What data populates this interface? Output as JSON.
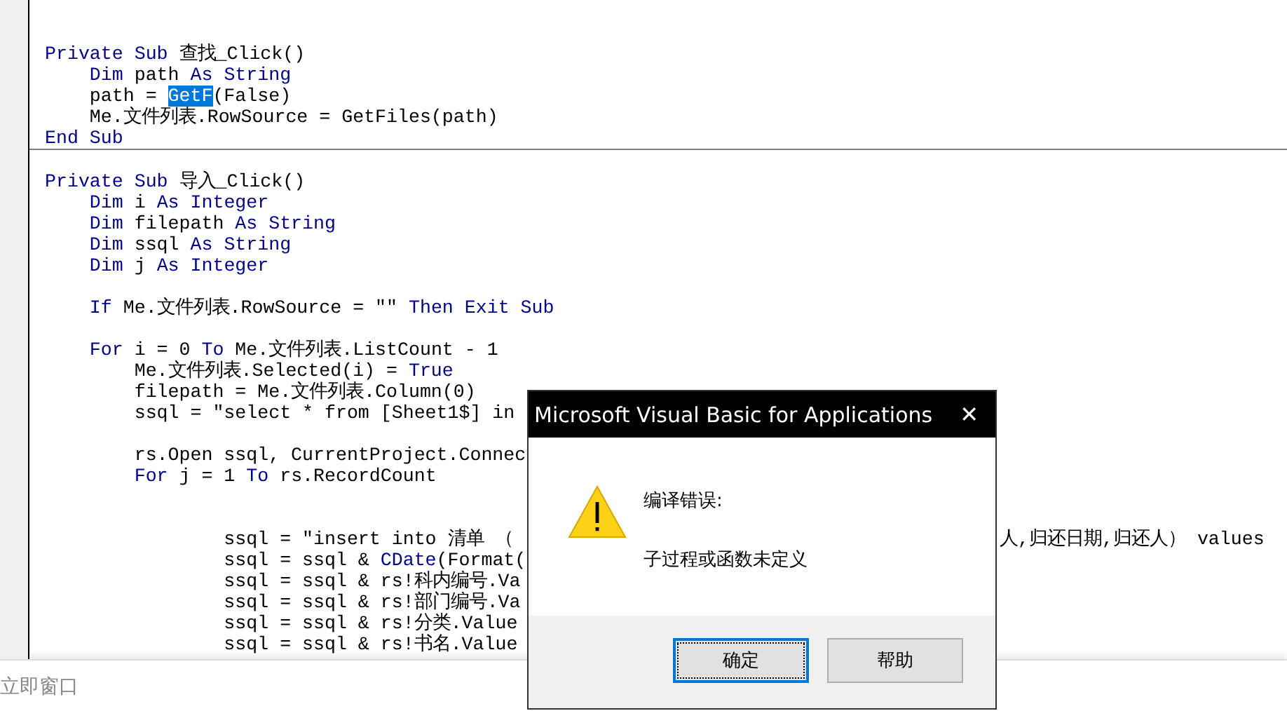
{
  "editor": {
    "procedures": [
      {
        "lines": [
          {
            "kind": "code",
            "tokens": [
              {
                "kind": "keyword",
                "text": "Private Sub"
              },
              {
                "kind": "plain",
                "text": " 查找_Click()"
              }
            ]
          },
          {
            "kind": "code",
            "tokens": [
              {
                "kind": "keyword",
                "text": "    Dim"
              },
              {
                "kind": "plain",
                "text": " path "
              },
              {
                "kind": "keyword",
                "text": "As String"
              }
            ]
          },
          {
            "kind": "code",
            "tokens": [
              {
                "kind": "plain",
                "text": "    path = "
              },
              {
                "kind": "selected",
                "text": "GetF"
              },
              {
                "kind": "plain",
                "text": "(False)"
              }
            ]
          },
          {
            "kind": "code",
            "tokens": [
              {
                "kind": "plain",
                "text": "    Me.文件列表.RowSource = GetFiles(path)"
              }
            ]
          },
          {
            "kind": "code",
            "tokens": [
              {
                "kind": "keyword",
                "text": "End Sub"
              }
            ]
          }
        ]
      },
      {
        "lines": [
          {
            "kind": "blank"
          },
          {
            "kind": "code",
            "tokens": [
              {
                "kind": "keyword",
                "text": "Private Sub"
              },
              {
                "kind": "plain",
                "text": " 导入_Click()"
              }
            ]
          },
          {
            "kind": "code",
            "tokens": [
              {
                "kind": "keyword",
                "text": "    Dim"
              },
              {
                "kind": "plain",
                "text": " i "
              },
              {
                "kind": "keyword",
                "text": "As Integer"
              }
            ]
          },
          {
            "kind": "code",
            "tokens": [
              {
                "kind": "keyword",
                "text": "    Dim"
              },
              {
                "kind": "plain",
                "text": " filepath "
              },
              {
                "kind": "keyword",
                "text": "As String"
              }
            ]
          },
          {
            "kind": "code",
            "tokens": [
              {
                "kind": "keyword",
                "text": "    Dim"
              },
              {
                "kind": "plain",
                "text": " ssql "
              },
              {
                "kind": "keyword",
                "text": "As String"
              }
            ]
          },
          {
            "kind": "code",
            "tokens": [
              {
                "kind": "keyword",
                "text": "    Dim"
              },
              {
                "kind": "plain",
                "text": " j "
              },
              {
                "kind": "keyword",
                "text": "As Integer"
              }
            ]
          },
          {
            "kind": "blank"
          },
          {
            "kind": "code",
            "tokens": [
              {
                "kind": "keyword",
                "text": "    If"
              },
              {
                "kind": "plain",
                "text": " Me.文件列表.RowSource = \"\" "
              },
              {
                "kind": "keyword",
                "text": "Then Exit Sub"
              }
            ]
          },
          {
            "kind": "blank"
          },
          {
            "kind": "code",
            "tokens": [
              {
                "kind": "keyword",
                "text": "    For"
              },
              {
                "kind": "plain",
                "text": " i = 0 "
              },
              {
                "kind": "keyword",
                "text": "To"
              },
              {
                "kind": "plain",
                "text": " Me.文件列表.ListCount - 1"
              }
            ]
          },
          {
            "kind": "code",
            "tokens": [
              {
                "kind": "plain",
                "text": "        Me.文件列表.Selected(i) = "
              },
              {
                "kind": "keyword",
                "text": "True"
              }
            ]
          },
          {
            "kind": "code",
            "tokens": [
              {
                "kind": "plain",
                "text": "        filepath = Me.文件列表.Column(0)"
              }
            ]
          },
          {
            "kind": "code",
            "tokens": [
              {
                "kind": "plain",
                "text": "        ssql = \"select * from [Sheet1$] in"
              }
            ]
          },
          {
            "kind": "blank"
          },
          {
            "kind": "code",
            "tokens": [
              {
                "kind": "plain",
                "text": "        rs.Open ssql, CurrentProject.Connec"
              }
            ]
          },
          {
            "kind": "code",
            "tokens": [
              {
                "kind": "keyword",
                "text": "        For"
              },
              {
                "kind": "plain",
                "text": " j = 1 "
              },
              {
                "kind": "keyword",
                "text": "To"
              },
              {
                "kind": "plain",
                "text": " rs.RecordCount"
              }
            ]
          },
          {
            "kind": "blank"
          },
          {
            "kind": "blank"
          },
          {
            "kind": "code",
            "tokens": [
              {
                "kind": "plain",
                "text": "                ssql = \"insert into 清单 （"
              }
            ],
            "tail": "人,归还日期,归还人） values"
          },
          {
            "kind": "code",
            "tokens": [
              {
                "kind": "plain",
                "text": "                ssql = ssql & "
              },
              {
                "kind": "keyword",
                "text": "CDate"
              },
              {
                "kind": "plain",
                "text": "(Format("
              }
            ]
          },
          {
            "kind": "code",
            "tokens": [
              {
                "kind": "plain",
                "text": "                ssql = ssql & rs!科内编号.Va"
              }
            ]
          },
          {
            "kind": "code",
            "tokens": [
              {
                "kind": "plain",
                "text": "                ssql = ssql & rs!部门编号.Va"
              }
            ]
          },
          {
            "kind": "code",
            "tokens": [
              {
                "kind": "plain",
                "text": "                ssql = ssql & rs!分类.Value"
              }
            ]
          },
          {
            "kind": "code",
            "tokens": [
              {
                "kind": "plain",
                "text": "                ssql = ssql & rs!书名.Value"
              }
            ]
          }
        ]
      }
    ]
  },
  "immediate_window": {
    "title": "立即窗口"
  },
  "dialog": {
    "title": "Microsoft Visual Basic for Applications",
    "close": "✕",
    "heading": "编译错误:",
    "message": "子过程或函数未定义",
    "buttons": [
      {
        "label": "确定",
        "focused": true
      },
      {
        "label": "帮助",
        "focused": false
      }
    ]
  }
}
